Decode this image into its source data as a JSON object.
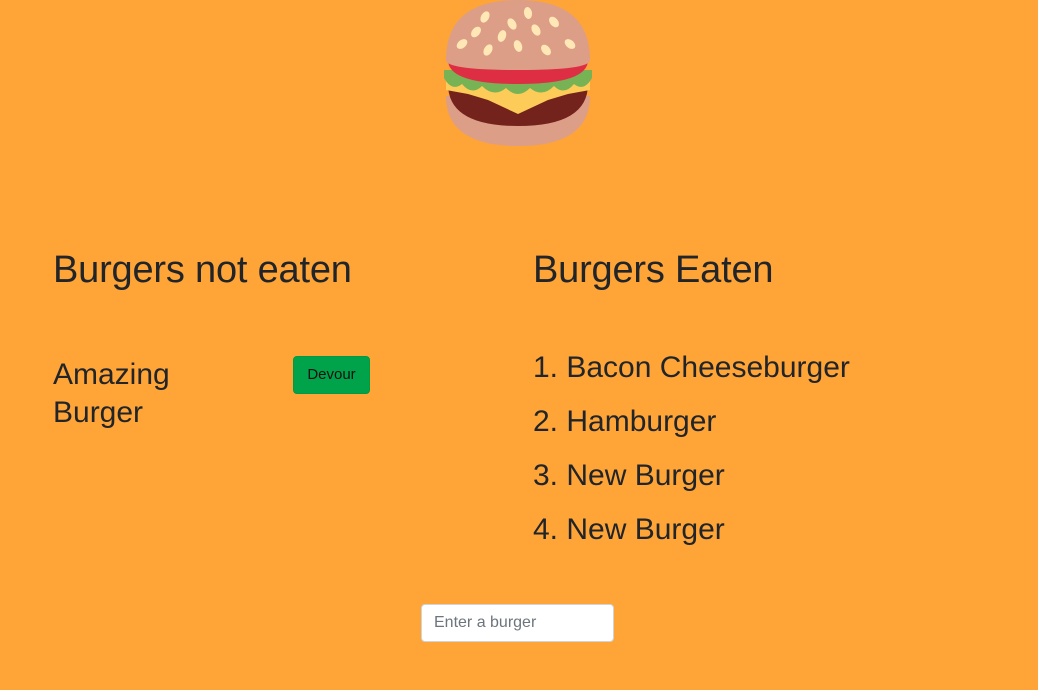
{
  "logo": {
    "icon": "hamburger-icon"
  },
  "not_eaten": {
    "title": "Burgers not eaten",
    "items": [
      {
        "name": "Amazing Burger",
        "button_label": "Devour"
      }
    ]
  },
  "eaten": {
    "title": "Burgers Eaten",
    "items": [
      "1. Bacon Cheeseburger",
      "2. Hamburger",
      "3. New Burger",
      "4. New Burger"
    ]
  },
  "form": {
    "input_value": "",
    "input_placeholder": "Enter a burger"
  },
  "colors": {
    "background": "#ffa436",
    "devour_button": "#00a34a",
    "text": "#212529"
  }
}
